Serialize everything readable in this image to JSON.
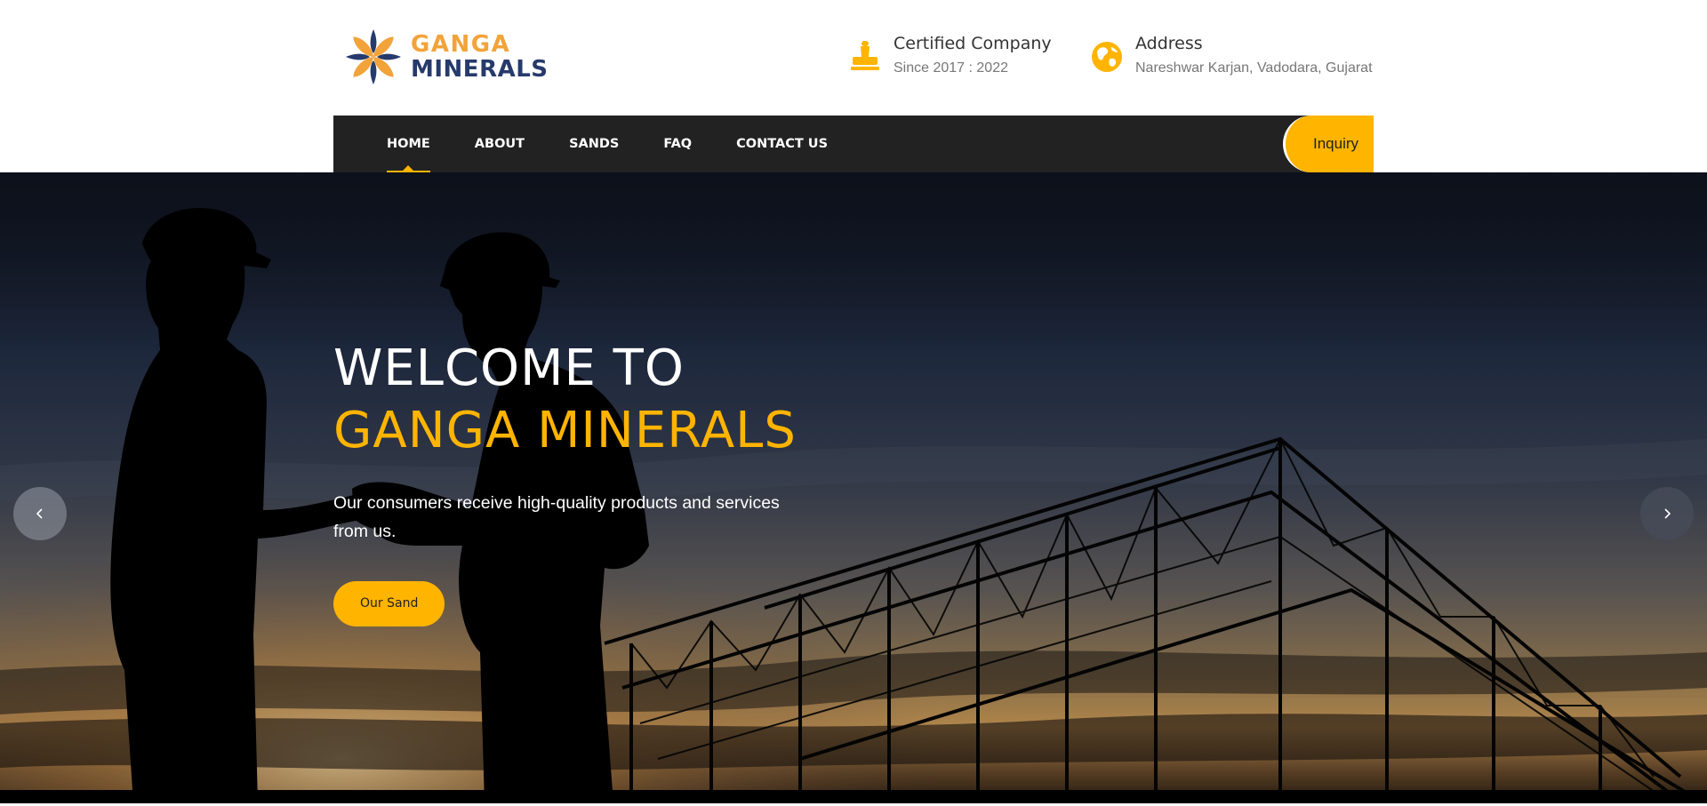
{
  "brand": {
    "name_line1": "GANGA",
    "name_line2": "MINERALS",
    "logo_icon": "flower-logo-icon",
    "colors": {
      "orange": "#f2a33a",
      "navy": "#263a6b"
    }
  },
  "header": {
    "certified": {
      "icon": "stamp-icon",
      "title": "Certified Company",
      "subtitle": "Since 2017 : 2022"
    },
    "address": {
      "icon": "globe-icon",
      "title": "Address",
      "subtitle": "Nareshwar Karjan, Vadodara, Gujarat"
    }
  },
  "nav": {
    "items": [
      {
        "label": "HOME",
        "active": true
      },
      {
        "label": "ABOUT",
        "active": false
      },
      {
        "label": "SANDS",
        "active": false
      },
      {
        "label": "FAQ",
        "active": false
      },
      {
        "label": "CONTACT US",
        "active": false
      }
    ],
    "inquiry_label": "Inquiry"
  },
  "hero": {
    "heading_line1": "WELCOME TO",
    "heading_line2": "GANGA MINERALS",
    "description": "Our consumers receive high-quality products and services from us.",
    "cta_label": "Our Sand",
    "prev_icon": "chevron-left-icon",
    "next_icon": "chevron-right-icon"
  },
  "theme": {
    "accent": "#ffb400",
    "nav_background": "#222222"
  }
}
